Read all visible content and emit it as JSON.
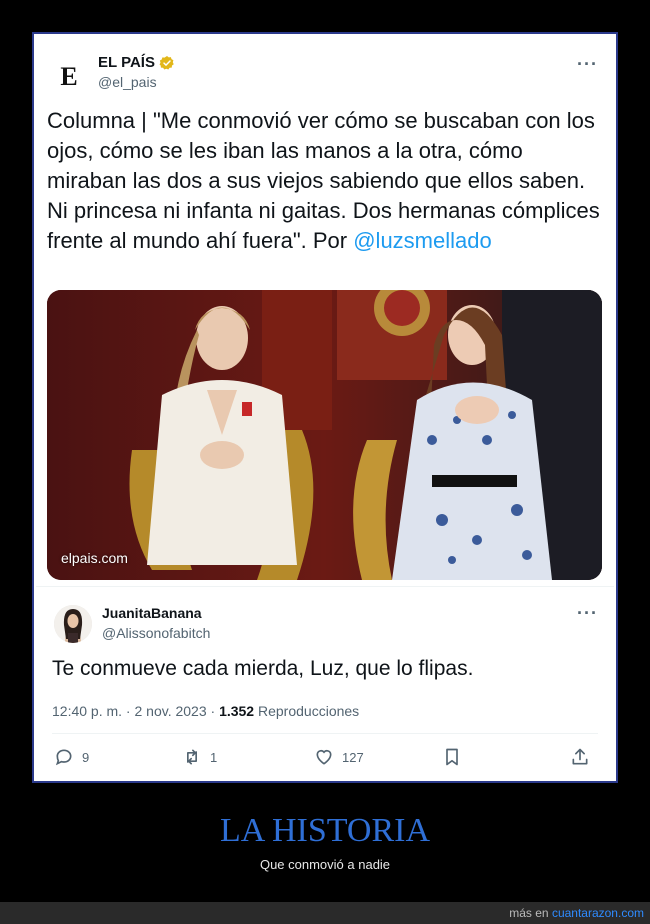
{
  "tweet": {
    "author_name": "EL PAÍS",
    "author_handle": "@el_pais",
    "logo_letter": "E",
    "text": "Columna | \"Me conmovió ver cómo se buscaban con los ojos, cómo se les iban las manos a la otra, cómo miraban las dos a sus viejos sabiendo que ellos saben. Ni princesa ni infanta ni gaitas. Dos hermanas cómplices frente al mundo ahí fuera\". Por ",
    "mention": "@luzsmellado",
    "more_label": "···",
    "photo_watermark": "elpais.com",
    "verified_color": "#e2b719"
  },
  "reply": {
    "author_name": "JuanitaBanana",
    "author_handle": "@Alissonofabitch",
    "more_label": "···",
    "text": "Te conmueve cada mierda, Luz, que lo flipas.",
    "time": "12:40 p. m. · 2 nov. 2023 · ",
    "views_count": "1.352",
    "views_label": " Reproducciones",
    "actions": {
      "replies": "9",
      "retweets": "1",
      "likes": "127"
    }
  },
  "caption": {
    "title": "LA HISTORIA",
    "subtitle": "Que conmovió a nadie"
  },
  "footer": {
    "prefix": "más en ",
    "site": "cuantarazon.com"
  },
  "colors": {
    "frame_border": "#2b3a8c",
    "link": "#1d9bf0",
    "caption_title": "#2f6fd6"
  }
}
